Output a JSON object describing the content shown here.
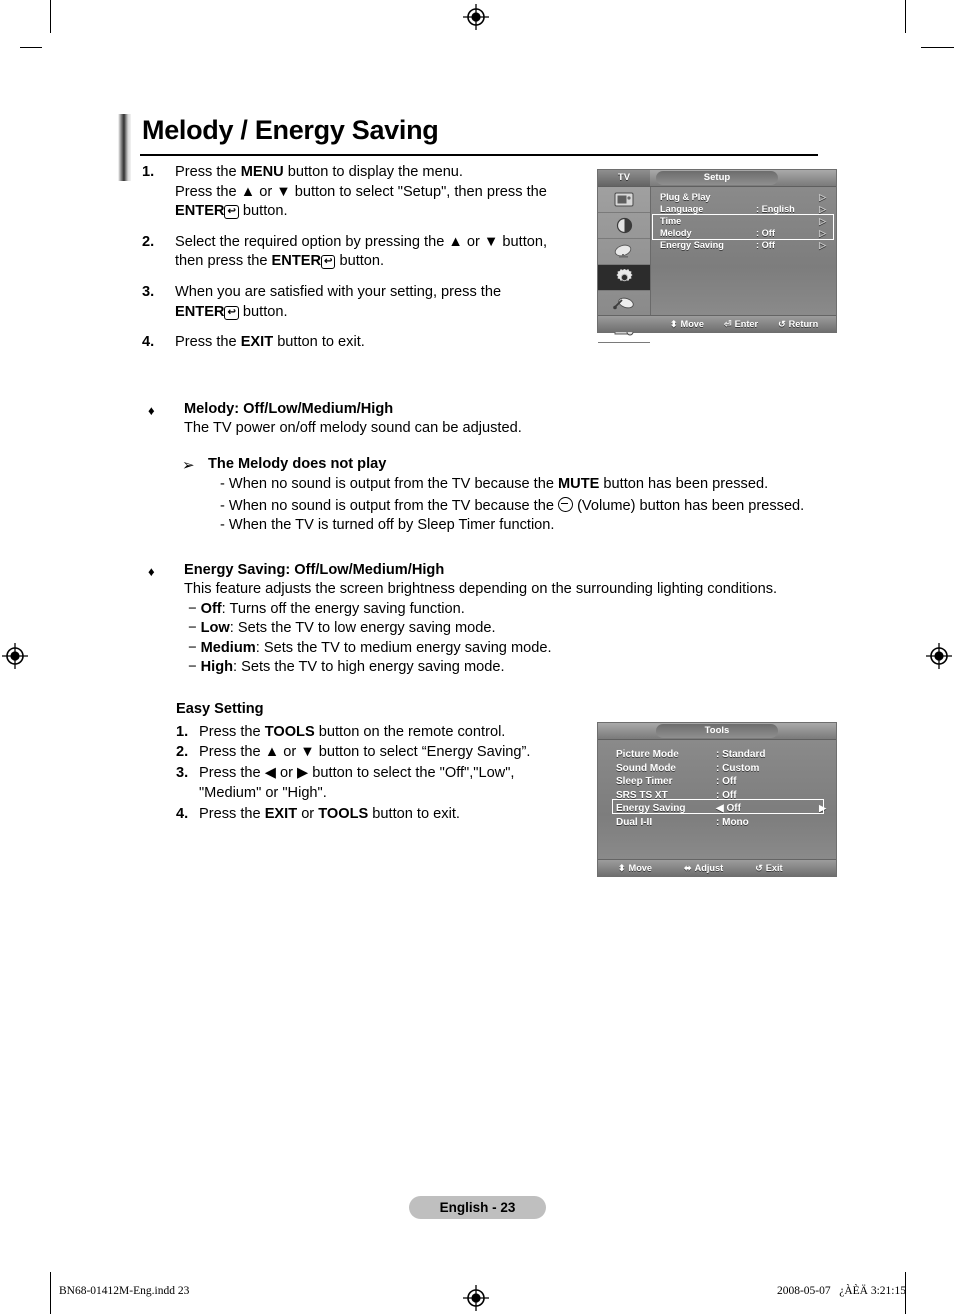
{
  "page": {
    "title": "Melody / Energy Saving",
    "footer_pill": "English - 23",
    "footer_left": "BN68-01412M-Eng.indd   23",
    "footer_right": "2008-05-07   ¿ÀÈÄ 3:21:15"
  },
  "steps": [
    {
      "num": "1.",
      "line1_a": "Press the ",
      "line1_b": "MENU",
      "line1_c": " button to display the menu.",
      "line2_a": "Press the ▲ or ▼ button to select \"Setup\", then press the",
      "line3_a": "ENTER",
      "line3_glyph": "↩",
      "line3_c": " button."
    },
    {
      "num": "2.",
      "line1_a": "Select the required option by pressing the ▲ or ▼ button,",
      "line2_a": "then press the ",
      "line2_b": "ENTER",
      "line2_glyph": "↩",
      "line2_c": " button."
    },
    {
      "num": "3.",
      "line1_a": "When you are satisfied with your setting, press the",
      "line2_b": "ENTER",
      "line2_glyph": "↩",
      "line2_c": " button."
    },
    {
      "num": "4.",
      "line1_a": "Press the ",
      "line1_b": "EXIT",
      "line1_c": " button to exit."
    }
  ],
  "melody_section": {
    "bullet": "♦",
    "heading": "Melody: Off/Low/Medium/High",
    "description": "The TV power on/off melody sound can be adjusted.",
    "note_arrow": "➢",
    "note_heading": "The Melody does not play",
    "note_items_1_a": "- When no sound is output from the TV because the ",
    "note_items_1_b": "MUTE",
    "note_items_1_c": " button has been pressed.",
    "note_items_2_a": "- When no sound is output from the TV because the ",
    "note_items_2_c": " (Volume) button has been pressed.",
    "note_items_3": "- When the TV is turned off by Sleep Timer function."
  },
  "energy_section": {
    "bullet": "♦",
    "heading": "Energy Saving: Off/Low/Medium/High",
    "description": "This feature adjusts the screen brightness depending on the surrounding lighting conditions.",
    "options": [
      {
        "dash": "−",
        "name": "Off",
        "desc": ": Turns off the energy saving function."
      },
      {
        "dash": "−",
        "name": "Low",
        "desc": ": Sets the TV to low energy saving mode."
      },
      {
        "dash": "−",
        "name": "Medium",
        "desc": ": Sets the TV to medium energy saving mode."
      },
      {
        "dash": "−",
        "name": "High",
        "desc": ": Sets the TV to high energy saving mode."
      }
    ]
  },
  "easy_setting": {
    "title": "Easy Setting",
    "steps": [
      {
        "num": "1.",
        "a": "Press the ",
        "b": "TOOLS",
        "c": " button on the remote control."
      },
      {
        "num": "2.",
        "a": "Press the ▲ or ▼ button to select “Energy Saving”."
      },
      {
        "num": "3.",
        "a": "Press the ◀ or ▶ button to select the \"Off\",\"Low\",",
        "line2": "\"Medium\" or \"High\"."
      },
      {
        "num": "4.",
        "a": "Press the ",
        "b": "EXIT",
        "c2": " or ",
        "d": "TOOLS",
        "e": " button to exit."
      }
    ]
  },
  "osd_setup": {
    "tv_tag": "TV",
    "title": "Setup",
    "sidebar_icons": [
      "picture-icon",
      "sound-icon",
      "channel-icon",
      "setup-gear-icon",
      "input-icon",
      "pc-setup-icon"
    ],
    "active_sidebar_index": 3,
    "rows": [
      {
        "label": "Plug & Play",
        "value": "",
        "arrow": "▷"
      },
      {
        "label": "Language",
        "value": ": English",
        "arrow": "▷"
      },
      {
        "label": "Time",
        "value": "",
        "arrow": "▷"
      },
      {
        "label": "Melody",
        "value": ": Off",
        "arrow": "▷"
      },
      {
        "label": "Energy Saving",
        "value": ": Off",
        "arrow": "▷"
      }
    ],
    "highlighted_rows": [
      3,
      4
    ],
    "footer": [
      {
        "icon": "⬍",
        "label": "Move"
      },
      {
        "icon": "⏎",
        "label": "Enter"
      },
      {
        "icon": "↺",
        "label": "Return"
      }
    ]
  },
  "osd_tools": {
    "title": "Tools",
    "rows": [
      {
        "label": "Picture Mode",
        "value": ": Standard",
        "left_arrow": "",
        "right_arrow": ""
      },
      {
        "label": "Sound Mode",
        "value": ": Custom",
        "left_arrow": "",
        "right_arrow": ""
      },
      {
        "label": "Sleep Timer",
        "value": ": Off",
        "left_arrow": "",
        "right_arrow": ""
      },
      {
        "label": "SRS TS XT",
        "value": ": Off",
        "left_arrow": "",
        "right_arrow": ""
      },
      {
        "label": "Energy Saving",
        "value": "Off",
        "left_arrow": "◀",
        "right_arrow": "▶"
      },
      {
        "label": "Dual I-II",
        "value": ": Mono",
        "left_arrow": "",
        "right_arrow": ""
      }
    ],
    "highlighted_row": 4,
    "footer": [
      {
        "icon": "⬍",
        "label": "Move"
      },
      {
        "icon": "⬌",
        "label": "Adjust"
      },
      {
        "icon": "↺",
        "label": "Exit"
      }
    ]
  }
}
